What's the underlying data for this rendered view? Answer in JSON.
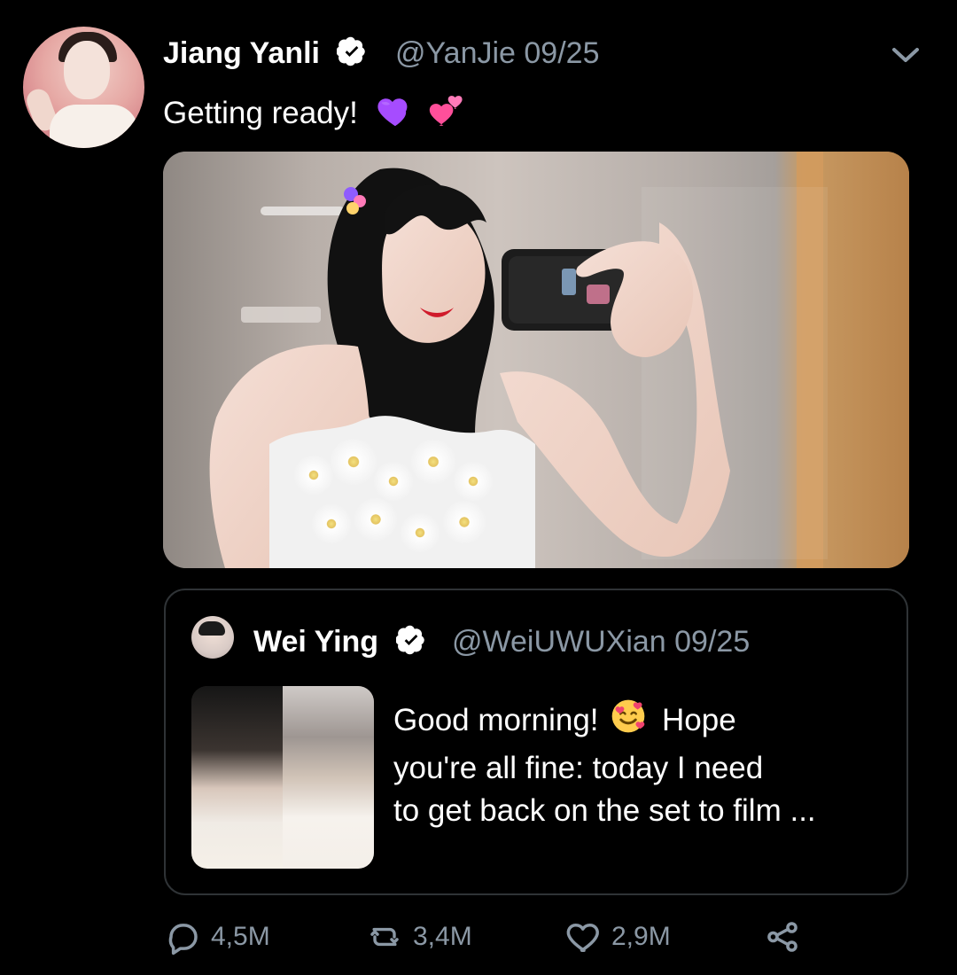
{
  "post": {
    "author": {
      "name": "Jiang Yanli",
      "handle": "@YanJie 09/25"
    },
    "text": "Getting ready!",
    "emojis": [
      "purple-heart",
      "two-hearts"
    ],
    "photo": {
      "description": ""
    },
    "more_icon": "chevron-down-icon"
  },
  "quote": {
    "author": {
      "name": "Wei Ying",
      "handle": "@WeiUWUXian 09/25"
    },
    "text_lines": [
      "Good morning! ",
      "Hope",
      "you're all fine: today I need",
      "to get back on the set to film ..."
    ],
    "emoji": "smiling-face-with-hearts"
  },
  "actions": {
    "replies": "4,5M",
    "retweets": "3,4M",
    "likes": "2,9M"
  },
  "colors": {
    "background": "#000000",
    "text": "#ffffff",
    "muted": "#8b98a5",
    "border": "#2f3336",
    "verified": "#ffffff"
  }
}
